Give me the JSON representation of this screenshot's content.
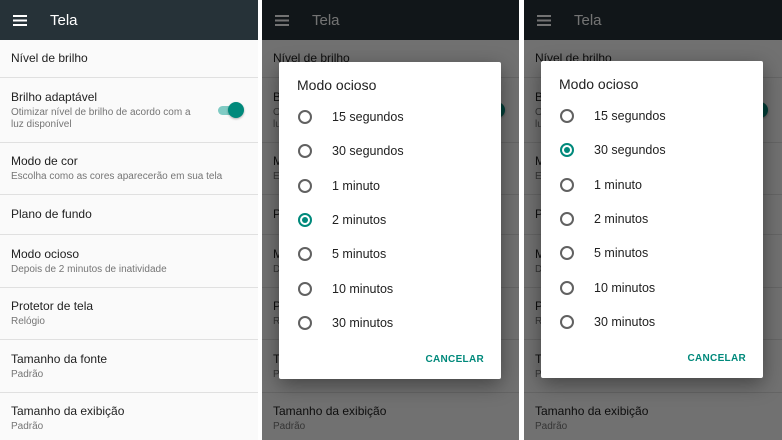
{
  "panels": [
    {
      "toolbar": {
        "title": "Tela"
      },
      "items": [
        {
          "title": "Nível de brilho",
          "subtitle": ""
        },
        {
          "title": "Brilho adaptável",
          "subtitle": "Otimizar nível de brilho de acordo com a luz disponível",
          "toggle_on": true
        },
        {
          "title": "Modo de cor",
          "subtitle": "Escolha como as cores aparecerão em sua tela"
        },
        {
          "title": "Plano de fundo",
          "subtitle": ""
        },
        {
          "title": "Modo ocioso",
          "subtitle": "Depois de 2 minutos de inatividade"
        },
        {
          "title": "Protetor de tela",
          "subtitle": "Relógio"
        },
        {
          "title": "Tamanho da fonte",
          "subtitle": "Padrão"
        },
        {
          "title": "Tamanho da exibição",
          "subtitle": "Padrão"
        }
      ]
    }
  ],
  "dialog": {
    "title": "Modo ocioso",
    "options": [
      "15 segundos",
      "30 segundos",
      "1 minuto",
      "2 minutos",
      "5 minutos",
      "10 minutos",
      "30 minutos"
    ],
    "cancel_label": "CANCELAR"
  },
  "dialog_panel2_selected": "2 minutos",
  "dialog_panel3_selected": "30 segundos",
  "colors": {
    "toolbar": "#263238",
    "accent": "#00897b",
    "scrim": "rgba(0,0,0,0.55)"
  }
}
